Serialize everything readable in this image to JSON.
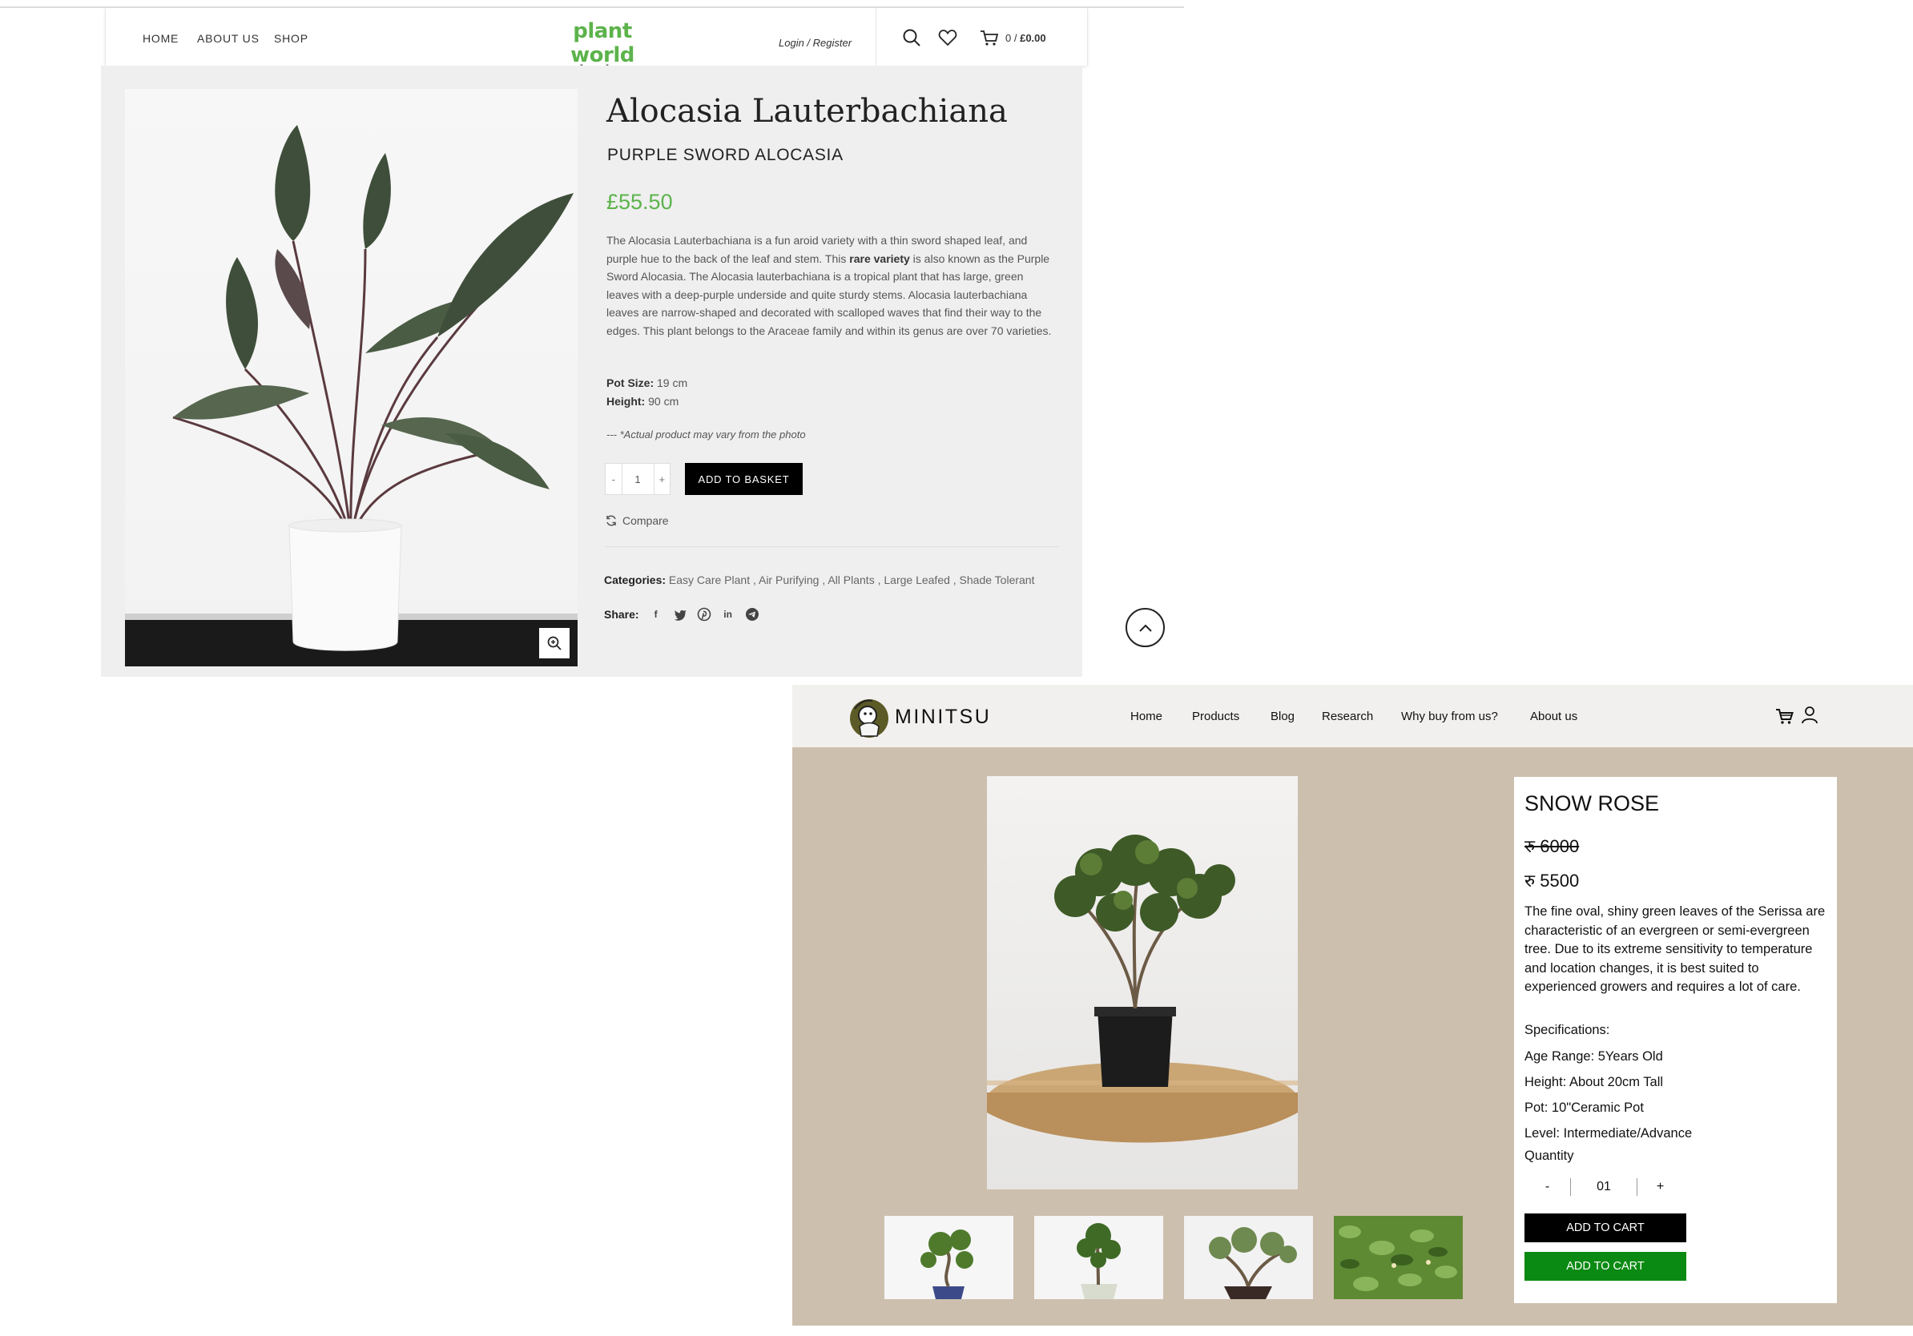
{
  "plantworld": {
    "nav": [
      "HOME",
      "ABOUT US",
      "SHOP"
    ],
    "logo_main": "plant world",
    "logo_sub": "london",
    "login": "Login / Register",
    "cart_count": "0 /",
    "cart_total": "£0.00",
    "product": {
      "title": "Alocasia Lauterbachiana",
      "subtitle": "PURPLE SWORD ALOCASIA",
      "price": "£55.50",
      "desc_part1": "The Alocasia Lauterbachiana is a fun aroid variety with a thin sword shaped leaf, and purple hue to the back of the leaf and stem. This ",
      "desc_bold": "rare variety",
      "desc_part2": " is also known as the Purple Sword Alocasia. The Alocasia lauterbachiana is a tropical plant that has large, green leaves with a deep-purple underside and quite sturdy stems. Alocasia lauterbachiana leaves are narrow-shaped and decorated with scalloped waves that find their way to the edges. This plant belongs to the Araceae family and within its genus are over 70 varieties.",
      "pot_size_label": "Pot Size:",
      "pot_size_value": " 19 cm",
      "height_label": "Height:",
      "height_value": " 90 cm",
      "note": "--- *Actual product may vary from the photo",
      "qty_minus": "-",
      "qty_value": "1",
      "qty_plus": "+",
      "add_button": "ADD TO BASKET",
      "compare": "Compare",
      "categories_label": "Categories:",
      "categories": "Easy Care Plant ,  Air Purifying ,  All Plants ,  Large Leafed ,  Shade Tolerant",
      "share_label": "Share:"
    },
    "icons": [
      "search-icon",
      "heart-icon",
      "cart-icon",
      "zoom-icon",
      "compare-icon",
      "facebook-icon",
      "twitter-icon",
      "pinterest-icon",
      "linkedin-icon",
      "telegram-icon",
      "chevron-up-icon"
    ],
    "accent": "#5cb34b"
  },
  "minitsu": {
    "logo_text": "MINITSU",
    "nav": [
      "Home",
      "Products",
      "Blog",
      "Research",
      "Why buy from us?",
      "About us"
    ],
    "product": {
      "title": "SNOW ROSE",
      "old_price": "रु 6000",
      "new_price": "रु 5500",
      "description": "The fine oval, shiny green leaves of the Serissa are characteristic of an evergreen or semi-evergreen tree. Due to its extreme sensitivity to temperature and location changes, it is best suited to experienced growers and requires a lot of care.",
      "specs_heading": "Specifications:",
      "specs": [
        "Age Range: 5Years Old",
        "Height: About 20cm Tall",
        "Pot: 10\"Ceramic Pot",
        "Level: Intermediate/Advance"
      ],
      "quantity_label": "Quantity",
      "qty_minus": "-",
      "qty_value": "01",
      "qty_plus": "+",
      "add_cart_1": "ADD TO CART",
      "add_cart_2": "ADD TO CART"
    },
    "icons": [
      "cart-icon",
      "user-icon"
    ],
    "colors": {
      "body_bg": "#cdbfae",
      "green_button": "#0a8a12"
    }
  }
}
